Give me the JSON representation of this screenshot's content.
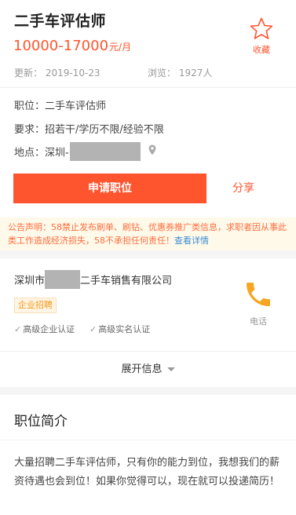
{
  "job": {
    "title": "二手车评估师",
    "salary": "10000-17000",
    "salary_unit": "元/月",
    "updated": "更新：  2019-10-23",
    "views": "浏览：  1927人",
    "favorite_label": "收藏"
  },
  "details": {
    "position": "职位：二手车评估师",
    "requirement": "要求：招若干/学历不限/经验不限",
    "location_prefix": "地点：深圳-"
  },
  "actions": {
    "apply_label": "申请职位",
    "share_label": "分享"
  },
  "notice": {
    "text": "公告声明：58禁止发布刷单、刷钻、优惠券推广类信息，求职者因从事此类工作造成经济损失，58不承担任何责任！",
    "link": "查看详情"
  },
  "company": {
    "name_prefix": "深圳市",
    "name_suffix": "二手车销售有限公司",
    "tag": "企业招聘",
    "auth1": "高级企业认证",
    "auth2": "高级实名认证",
    "phone_label": "电话",
    "expand_label": "展开信息"
  },
  "intro": {
    "title": "职位简介",
    "body": "大量招聘二手车评估师，只有你的能力到位，我想我们的薪资待遇也会到位！如果你觉得可以，现在就可以投递简历！"
  },
  "colors": {
    "accent": "#ff552e",
    "phone_icon": "#f5a623",
    "notice_bg": "#fff9ea",
    "link": "#3a8dd5"
  },
  "icons": [
    "star-outline-icon",
    "location-pin-icon",
    "check-icon",
    "phone-icon",
    "caret-down-icon"
  ]
}
